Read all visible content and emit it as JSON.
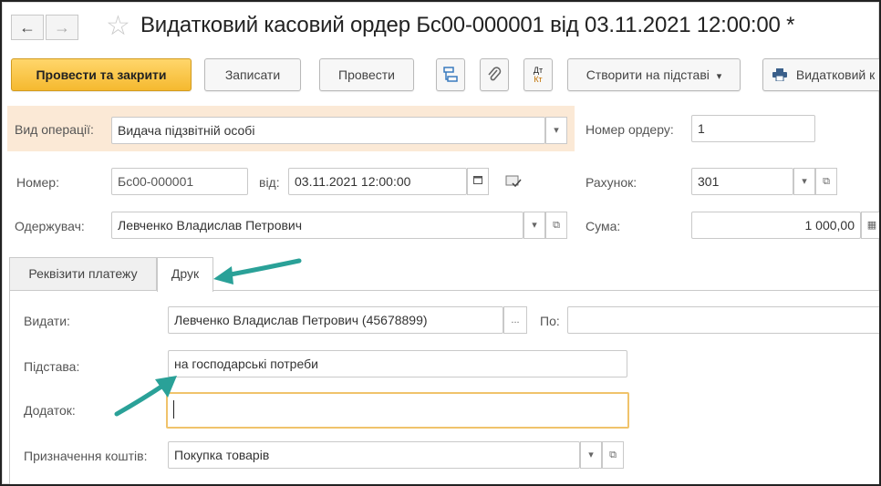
{
  "title_bar": {
    "back_glyph": "←",
    "forward_glyph": "→",
    "favorite_glyph": "☆",
    "title": "Видатковий касовий ордер Бс00-000001 від 03.11.2021 12:00:00 *"
  },
  "toolbar": {
    "post_close": "Провести та закрити",
    "save": "Записати",
    "post": "Провести",
    "dt_kt_top": "Дт",
    "dt_kt_bottom": "Кт",
    "create_based": "Створити на підставі",
    "dropdown_glyph": "▾",
    "print": "Видатковий к"
  },
  "form": {
    "operation_type_label": "Вид операції:",
    "operation_type_value": "Видача підзвітній особі",
    "order_number_label": "Номер ордеру:",
    "order_number_value": "1",
    "number_label": "Номер:",
    "number_value": "Бс00-000001",
    "date_label": "від:",
    "date_value": "03.11.2021 12:00:00",
    "account_label": "Рахунок:",
    "account_value": "301",
    "recipient_label": "Одержувач:",
    "recipient_value": "Левченко Владислав Петрович",
    "amount_label": "Сума:",
    "amount_value": "1 000,00"
  },
  "tabs": [
    {
      "label": "Реквізити платежу",
      "active": false
    },
    {
      "label": "Друк",
      "active": true
    }
  ],
  "print_tab": {
    "issue_label": "Видати:",
    "issue_value": "Левченко Владислав Петрович (45678899)",
    "ellipsis": "...",
    "by_label": "По:",
    "by_value": "",
    "basis_label": "Підстава:",
    "basis_value": "на господарські потреби",
    "attachment_label": "Додаток:",
    "attachment_value": "",
    "purpose_label": "Призначення коштів:",
    "purpose_value": "Покупка товарів"
  },
  "colors": {
    "primary_button": "#f5b92f",
    "operation_highlight": "#fbe9d6",
    "focus_border": "#f0c36b",
    "annotation_arrow": "#2aa198"
  },
  "icons": [
    "back-arrow-icon",
    "forward-arrow-icon",
    "star-icon",
    "structure-icon",
    "paperclip-icon",
    "dt-kt-icon",
    "printer-icon",
    "calendar-icon",
    "document-check-icon",
    "open-form-icon",
    "calculator-icon",
    "dropdown-icon",
    "annotation-arrow-icon"
  ]
}
